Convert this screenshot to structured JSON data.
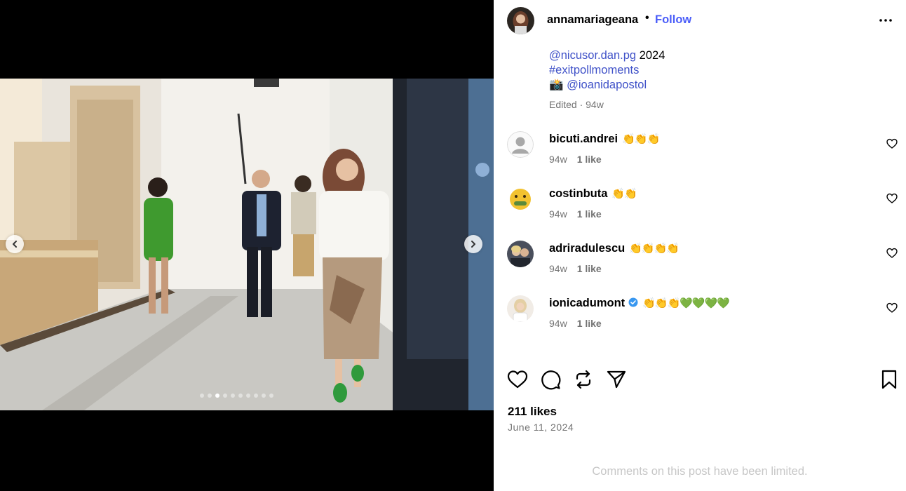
{
  "post": {
    "username": "annamariageana",
    "separator": "•",
    "follow_label": "Follow",
    "caption_lines": [
      {
        "type": "mention_text",
        "mention": "@nicusor.dan.pg",
        "text": " 2024"
      },
      {
        "type": "hashtag",
        "text": "#exitpollmoments"
      },
      {
        "type": "credit",
        "emoji": "📸",
        "mention": "@ioanidapostol"
      }
    ],
    "caption_meta": "Edited · 94w",
    "likes": "211 likes",
    "date": "June 11, 2024",
    "comments_limited": "Comments on this post have been limited."
  },
  "carousel": {
    "slide_count": 10,
    "active_index": 2
  },
  "comments": [
    {
      "username": "bicuti.andrei",
      "text": "👏👏👏",
      "age": "94w",
      "likes": "1 like",
      "verified": false,
      "avatar": "default-avatar"
    },
    {
      "username": "costinbuta",
      "text": "👏👏",
      "age": "94w",
      "likes": "1 like",
      "verified": false,
      "avatar": "money-mouth-avatar"
    },
    {
      "username": "adriradulescu",
      "text": "👏👏👏👏",
      "age": "94w",
      "likes": "1 like",
      "verified": false,
      "avatar": "couple-photo-avatar"
    },
    {
      "username": "ionicadumont",
      "text": "👏👏👏💚💚💚💚",
      "age": "94w",
      "likes": "1 like",
      "verified": true,
      "avatar": "portrait-avatar"
    }
  ],
  "colors": {
    "follow": "#4a5df9",
    "mention": "#3f51c8",
    "muted": "#737373",
    "verified": "#3897f0"
  },
  "icons": [
    "more-icon",
    "heart-icon",
    "comment-icon",
    "repost-icon",
    "share-icon",
    "bookmark-icon",
    "chevron-left-icon",
    "chevron-right-icon",
    "verified-badge-icon"
  ]
}
